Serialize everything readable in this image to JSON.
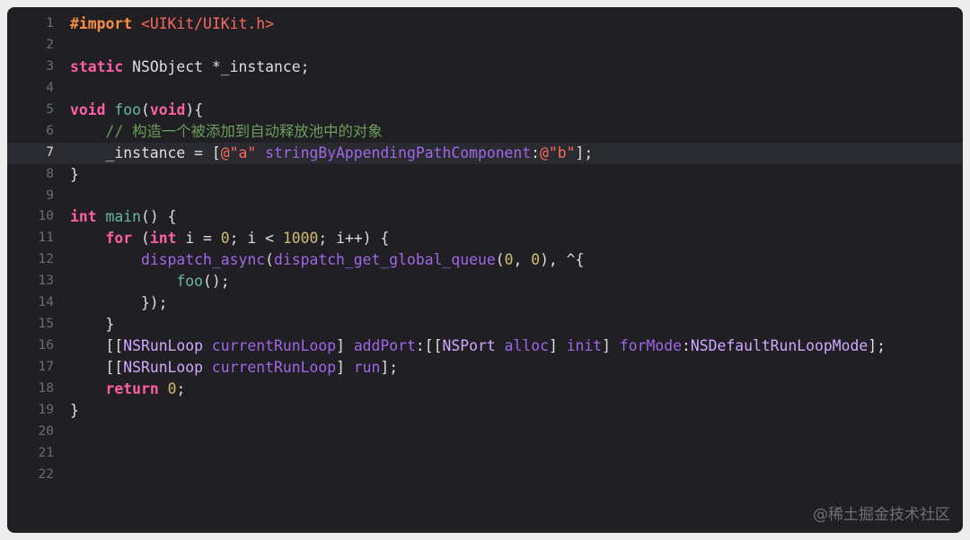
{
  "editor": {
    "current_line": 7,
    "colors": {
      "background": "#1f1f24",
      "current_line_bg": "#2a2b30",
      "plain": "#dfdfe0",
      "line_number": "#6c6c72",
      "keyword": "#fc5fa3",
      "preprocessor": "#fd8f3f",
      "string": "#fc6a5d",
      "number": "#d0bf69",
      "comment": "#6c9c5a",
      "function": "#67b7a4",
      "method": "#a167e6",
      "type": "#d0a8ff"
    },
    "lines": [
      {
        "num": "1",
        "tokens": [
          {
            "t": "#import",
            "c": "preprocessor"
          },
          {
            "t": " ",
            "c": "plain"
          },
          {
            "t": "<UIKit/UIKit.h>",
            "c": "string"
          }
        ]
      },
      {
        "num": "2",
        "tokens": []
      },
      {
        "num": "3",
        "tokens": [
          {
            "t": "static",
            "c": "keyword"
          },
          {
            "t": " NSObject *_instance;",
            "c": "plain"
          }
        ]
      },
      {
        "num": "4",
        "tokens": []
      },
      {
        "num": "5",
        "tokens": [
          {
            "t": "void",
            "c": "keyword"
          },
          {
            "t": " ",
            "c": "plain"
          },
          {
            "t": "foo",
            "c": "function"
          },
          {
            "t": "(",
            "c": "plain"
          },
          {
            "t": "void",
            "c": "keyword"
          },
          {
            "t": "){",
            "c": "plain"
          }
        ]
      },
      {
        "num": "6",
        "tokens": [
          {
            "t": "    // 构造一个被添加到自动释放池中的对象",
            "c": "comment"
          }
        ]
      },
      {
        "num": "7",
        "tokens": [
          {
            "t": "    _instance = [",
            "c": "plain"
          },
          {
            "t": "@\"a\"",
            "c": "string"
          },
          {
            "t": " ",
            "c": "plain"
          },
          {
            "t": "stringByAppendingPathComponent",
            "c": "method"
          },
          {
            "t": ":",
            "c": "plain"
          },
          {
            "t": "@\"b\"",
            "c": "string"
          },
          {
            "t": "];",
            "c": "plain"
          }
        ]
      },
      {
        "num": "8",
        "tokens": [
          {
            "t": "}",
            "c": "plain"
          }
        ]
      },
      {
        "num": "9",
        "tokens": []
      },
      {
        "num": "10",
        "tokens": [
          {
            "t": "int",
            "c": "keyword"
          },
          {
            "t": " ",
            "c": "plain"
          },
          {
            "t": "main",
            "c": "function"
          },
          {
            "t": "() {",
            "c": "plain"
          }
        ]
      },
      {
        "num": "11",
        "tokens": [
          {
            "t": "    ",
            "c": "plain"
          },
          {
            "t": "for",
            "c": "keyword"
          },
          {
            "t": " (",
            "c": "plain"
          },
          {
            "t": "int",
            "c": "keyword"
          },
          {
            "t": " i = ",
            "c": "plain"
          },
          {
            "t": "0",
            "c": "number"
          },
          {
            "t": "; i < ",
            "c": "plain"
          },
          {
            "t": "1000",
            "c": "number"
          },
          {
            "t": "; i++) {",
            "c": "plain"
          }
        ]
      },
      {
        "num": "12",
        "tokens": [
          {
            "t": "        ",
            "c": "plain"
          },
          {
            "t": "dispatch_async",
            "c": "method"
          },
          {
            "t": "(",
            "c": "plain"
          },
          {
            "t": "dispatch_get_global_queue",
            "c": "method"
          },
          {
            "t": "(",
            "c": "plain"
          },
          {
            "t": "0",
            "c": "number"
          },
          {
            "t": ", ",
            "c": "plain"
          },
          {
            "t": "0",
            "c": "number"
          },
          {
            "t": "), ^{",
            "c": "plain"
          }
        ]
      },
      {
        "num": "13",
        "tokens": [
          {
            "t": "            ",
            "c": "plain"
          },
          {
            "t": "foo",
            "c": "function"
          },
          {
            "t": "();",
            "c": "plain"
          }
        ]
      },
      {
        "num": "14",
        "tokens": [
          {
            "t": "        });",
            "c": "plain"
          }
        ]
      },
      {
        "num": "15",
        "tokens": [
          {
            "t": "    }",
            "c": "plain"
          }
        ]
      },
      {
        "num": "16",
        "tokens": [
          {
            "t": "    [[",
            "c": "plain"
          },
          {
            "t": "NSRunLoop",
            "c": "type"
          },
          {
            "t": " ",
            "c": "plain"
          },
          {
            "t": "currentRunLoop",
            "c": "method"
          },
          {
            "t": "] ",
            "c": "plain"
          },
          {
            "t": "addPort",
            "c": "method"
          },
          {
            "t": ":[[",
            "c": "plain"
          },
          {
            "t": "NSPort",
            "c": "type"
          },
          {
            "t": " ",
            "c": "plain"
          },
          {
            "t": "alloc",
            "c": "method"
          },
          {
            "t": "] ",
            "c": "plain"
          },
          {
            "t": "init",
            "c": "method"
          },
          {
            "t": "] ",
            "c": "plain"
          },
          {
            "t": "forMode",
            "c": "method"
          },
          {
            "t": ":",
            "c": "plain"
          },
          {
            "t": "NSDefaultRunLoopMode",
            "c": "type"
          },
          {
            "t": "];",
            "c": "plain"
          }
        ]
      },
      {
        "num": "17",
        "tokens": [
          {
            "t": "    [[",
            "c": "plain"
          },
          {
            "t": "NSRunLoop",
            "c": "type"
          },
          {
            "t": " ",
            "c": "plain"
          },
          {
            "t": "currentRunLoop",
            "c": "method"
          },
          {
            "t": "] ",
            "c": "plain"
          },
          {
            "t": "run",
            "c": "method"
          },
          {
            "t": "];",
            "c": "plain"
          }
        ]
      },
      {
        "num": "18",
        "tokens": [
          {
            "t": "    ",
            "c": "plain"
          },
          {
            "t": "return",
            "c": "keyword"
          },
          {
            "t": " ",
            "c": "plain"
          },
          {
            "t": "0",
            "c": "number"
          },
          {
            "t": ";",
            "c": "plain"
          }
        ]
      },
      {
        "num": "19",
        "tokens": [
          {
            "t": "}",
            "c": "plain"
          }
        ]
      },
      {
        "num": "20",
        "tokens": []
      },
      {
        "num": "21",
        "tokens": []
      },
      {
        "num": "22",
        "tokens": []
      }
    ]
  },
  "watermark": "@稀土掘金技术社区"
}
